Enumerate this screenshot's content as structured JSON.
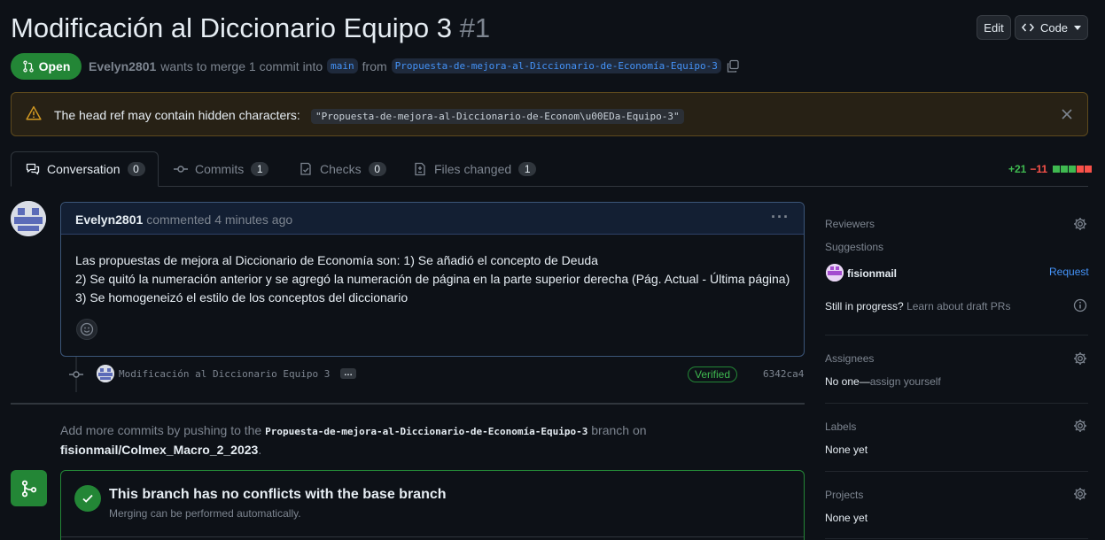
{
  "header": {
    "title": "Modificación al Diccionario Equipo 3",
    "number": "#1",
    "edit_label": "Edit",
    "code_label": "Code"
  },
  "status": {
    "badge": "Open",
    "author": "Evelyn2801",
    "text_merge": "wants to merge 1 commit into",
    "base_branch": "main",
    "text_from": "from",
    "head_branch": "Propuesta-de-mejora-al-Diccionario-de-Economía-Equipo-3"
  },
  "warning": {
    "text": "The head ref may contain hidden characters:",
    "code": "\"Propuesta-de-mejora-al-Diccionario-de-Econom\\u00EDa-Equipo-3\""
  },
  "tabs": [
    {
      "label": "Conversation",
      "count": "0"
    },
    {
      "label": "Commits",
      "count": "1"
    },
    {
      "label": "Checks",
      "count": "0"
    },
    {
      "label": "Files changed",
      "count": "1"
    }
  ],
  "diffstat": {
    "added": "+21",
    "removed": "−11"
  },
  "comment": {
    "author": "Evelyn2801",
    "meta": "commented 4 minutes ago",
    "lines": [
      "Las propuestas de mejora al Diccionario de Economía son: 1) Se añadió el concepto de Deuda",
      "2) Se quitó la numeración anterior y se agregó la numeración de página en la parte superior derecha (Pág. Actual - Última página)",
      "3) Se homogeneizó el estilo de los conceptos del diccionario"
    ]
  },
  "commit": {
    "message": "Modificación al Diccionario Equipo 3",
    "ellipsis": "…",
    "verified": "Verified",
    "sha": "6342ca4"
  },
  "push": {
    "prefix": "Add more commits by pushing to the",
    "branch": "Propuesta-de-mejora-al-Diccionario-de-Economía-Equipo-3",
    "suffix": "branch on",
    "repo": "fisionmail/Colmex_Macro_2_2023",
    "period": "."
  },
  "merge": {
    "title": "This branch has no conflicts with the base branch",
    "subtitle": "Merging can be performed automatically."
  },
  "sidebar": {
    "reviewers": {
      "heading": "Reviewers",
      "suggestions": "Suggestions",
      "user": "fisionmail",
      "request": "Request",
      "draft_q": "Still in progress?",
      "draft_link": "Learn about draft PRs"
    },
    "assignees": {
      "heading": "Assignees",
      "none": "No one—",
      "assign": "assign yourself"
    },
    "labels": {
      "heading": "Labels",
      "none": "None yet"
    },
    "projects": {
      "heading": "Projects",
      "none": "None yet"
    }
  },
  "colors": {
    "open": "#238636",
    "link": "#4493f8",
    "bg": "#0d1117",
    "warn_bg": "#272115"
  }
}
